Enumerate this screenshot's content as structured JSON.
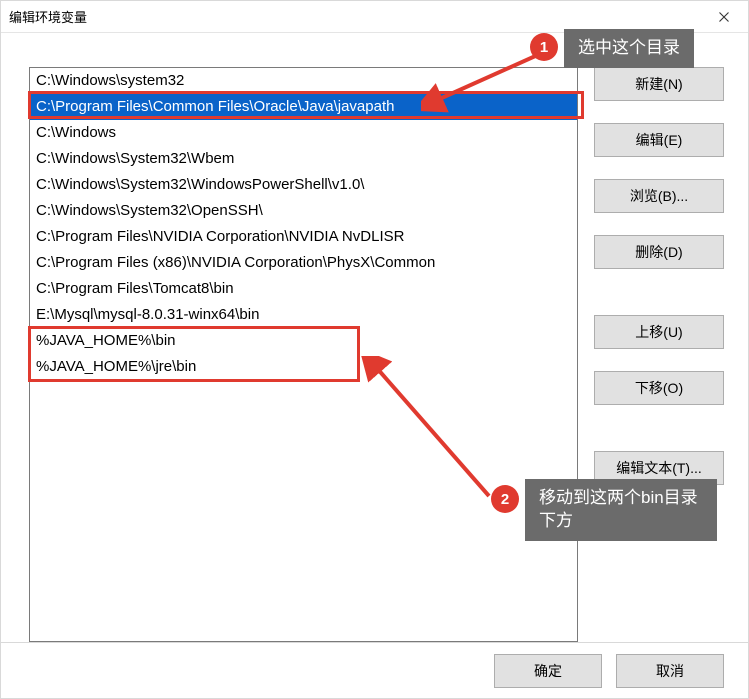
{
  "window": {
    "title": "编辑环境变量"
  },
  "paths": [
    {
      "text": "C:\\Windows\\system32",
      "selected": false
    },
    {
      "text": "C:\\Program Files\\Common Files\\Oracle\\Java\\javapath",
      "selected": true
    },
    {
      "text": "C:\\Windows",
      "selected": false
    },
    {
      "text": "C:\\Windows\\System32\\Wbem",
      "selected": false
    },
    {
      "text": "C:\\Windows\\System32\\WindowsPowerShell\\v1.0\\",
      "selected": false
    },
    {
      "text": "C:\\Windows\\System32\\OpenSSH\\",
      "selected": false
    },
    {
      "text": "C:\\Program Files\\NVIDIA Corporation\\NVIDIA NvDLISR",
      "selected": false
    },
    {
      "text": "C:\\Program Files (x86)\\NVIDIA Corporation\\PhysX\\Common",
      "selected": false
    },
    {
      "text": "C:\\Program Files\\Tomcat8\\bin",
      "selected": false
    },
    {
      "text": "E:\\Mysql\\mysql-8.0.31-winx64\\bin",
      "selected": false
    },
    {
      "text": "%JAVA_HOME%\\bin",
      "selected": false
    },
    {
      "text": "%JAVA_HOME%\\jre\\bin",
      "selected": false
    }
  ],
  "buttons": {
    "new": "新建(N)",
    "edit": "编辑(E)",
    "browse": "浏览(B)...",
    "delete": "删除(D)",
    "moveup": "上移(U)",
    "movedown": "下移(O)",
    "edittext": "编辑文本(T)...",
    "ok": "确定",
    "cancel": "取消"
  },
  "annotations": {
    "badge1": "1",
    "tip1": "选中这个目录",
    "badge2": "2",
    "tip2": "移动到这两个bin目录下方"
  }
}
